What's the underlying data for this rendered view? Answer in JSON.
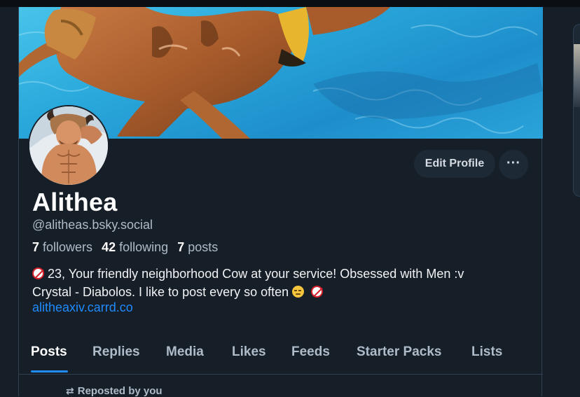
{
  "profile": {
    "display_name": "Alithea",
    "handle": "@alitheas.bsky.social",
    "stats": {
      "followers_count": "7",
      "followers_label": "followers",
      "following_count": "42",
      "following_label": "following",
      "posts_count": "7",
      "posts_label": "posts"
    },
    "bio": {
      "line1_text": "23, Your friendly neighborhood Cow at your service! Obsessed with Men :v",
      "line2_text": "Crystal - Diabolos. I like to post every so often",
      "link": "alitheaxiv.carrd.co"
    }
  },
  "actions": {
    "edit_profile_label": "Edit Profile",
    "more_label": "···"
  },
  "tabs": [
    {
      "label": "Posts"
    },
    {
      "label": "Replies"
    },
    {
      "label": "Media"
    },
    {
      "label": "Likes"
    },
    {
      "label": "Feeds"
    },
    {
      "label": "Starter Packs"
    },
    {
      "label": "Lists"
    }
  ],
  "feed": {
    "repost_label": "Reposted by you",
    "repost_icon": "repost-icon"
  },
  "colors": {
    "background": "#161e27",
    "link": "#208bfe",
    "muted_text": "#aebbc9",
    "button_bg": "#1e2936"
  },
  "icons": {
    "eighteen_plus": "18-plus-icon",
    "sad_face": "pensive-face-emoji",
    "more": "ellipsis-icon"
  }
}
